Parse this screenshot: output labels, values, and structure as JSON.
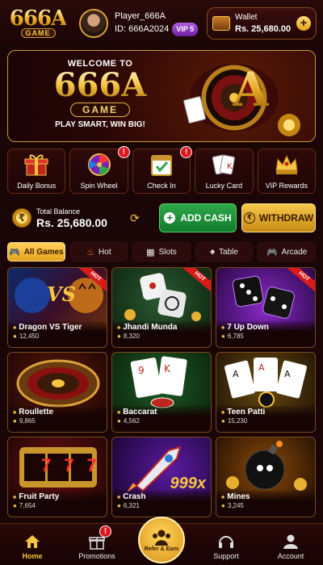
{
  "header": {
    "logo_main": "666A",
    "logo_sub": "GAME",
    "player_name": "Player_666A",
    "player_id": "ID: 666A2024",
    "vip_badge": "VIP 5",
    "wallet_label": "Wallet",
    "wallet_amount": "Rs. 25,680.00",
    "add_label": "+"
  },
  "banner": {
    "welcome": "WELCOME TO",
    "title": "666A",
    "game": "GAME",
    "tagline": "PLAY SMART, WIN BIG!",
    "art_letter": "A"
  },
  "quick_menu": [
    {
      "label": "Daily Bonus",
      "icon": "gift-icon",
      "badge": ""
    },
    {
      "label": "Spin Wheel",
      "icon": "wheel-icon",
      "badge": "!"
    },
    {
      "label": "Check In",
      "icon": "calendar-check-icon",
      "badge": "!"
    },
    {
      "label": "Lucky Card",
      "icon": "cards-icon",
      "badge": ""
    },
    {
      "label": "VIP Rewards",
      "icon": "crown-icon",
      "badge": ""
    }
  ],
  "balance": {
    "label": "Total Balance",
    "amount": "Rs. 25,680.00",
    "coin_symbol": "₹",
    "add_cash": "ADD CASH",
    "withdraw": "WITHDRAW"
  },
  "tabs": [
    {
      "label": "All Games",
      "icon": "gamepad-icon",
      "active": true
    },
    {
      "label": "Hot",
      "icon": "flame-icon",
      "active": false
    },
    {
      "label": "Slots",
      "icon": "slot-icon",
      "active": false
    },
    {
      "label": "Table",
      "icon": "spade-icon",
      "active": false
    },
    {
      "label": "Arcade",
      "icon": "gamepad-icon",
      "active": false
    }
  ],
  "games": [
    {
      "name": "Dragon VS Tiger",
      "players": "12,450",
      "hot": "HOT",
      "art_text": "VS"
    },
    {
      "name": "Jhandi Munda",
      "players": "8,320",
      "hot": "HOT",
      "art_text": ""
    },
    {
      "name": "7 Up Down",
      "players": "6,785",
      "hot": "HOT",
      "art_text": ""
    },
    {
      "name": "Roullette",
      "players": "9,865",
      "hot": "",
      "art_text": ""
    },
    {
      "name": "Baccarat",
      "players": "4,562",
      "hot": "",
      "art_text": ""
    },
    {
      "name": "Teen Patti",
      "players": "15,230",
      "hot": "",
      "art_text": ""
    },
    {
      "name": "Fruit Party",
      "players": "7,654",
      "hot": "",
      "art_text": "777"
    },
    {
      "name": "Crash",
      "players": "6,321",
      "hot": "",
      "art_text": "999x"
    },
    {
      "name": "Mines",
      "players": "3,245",
      "hot": "",
      "art_text": ""
    }
  ],
  "nav": {
    "home": "Home",
    "promotions": "Promotions",
    "promotions_badge": "!",
    "refer": "Refer & Earn",
    "support": "Support",
    "account": "Account"
  },
  "colors": {
    "accent_gold": "#f5c542",
    "background": "#1a0606",
    "add_cash_green": "#1f9a3d",
    "badge_red": "#e0161c"
  }
}
